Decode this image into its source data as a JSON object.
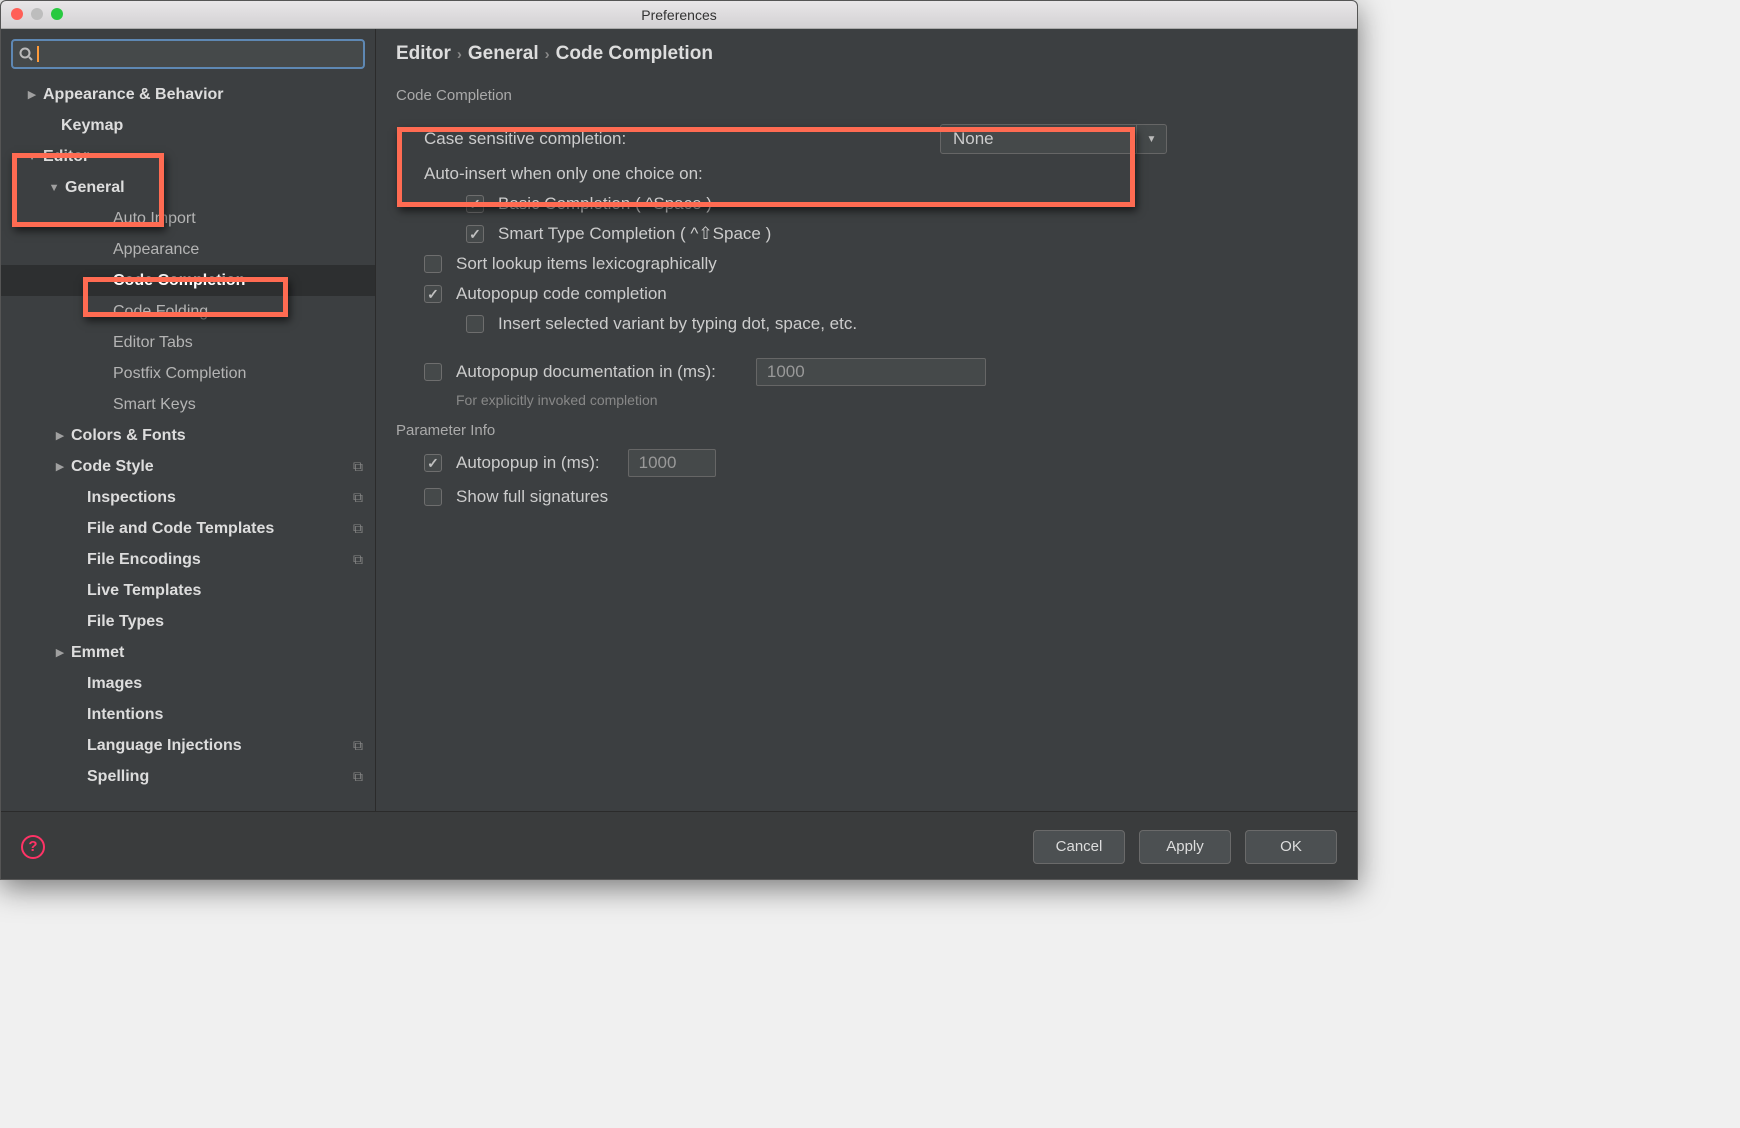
{
  "window_title": "Preferences",
  "sidebar": {
    "items": [
      {
        "label": "Appearance & Behavior",
        "indent": 26,
        "arrow": "▶",
        "bold": true
      },
      {
        "label": "Keymap",
        "indent": 44,
        "arrow": "",
        "bold": true
      },
      {
        "label": "Editor",
        "indent": 26,
        "arrow": "▼",
        "bold": true
      },
      {
        "label": "General",
        "indent": 48,
        "arrow": "▼",
        "bold": true
      },
      {
        "label": "Auto Import",
        "indent": 96,
        "arrow": ""
      },
      {
        "label": "Appearance",
        "indent": 96,
        "arrow": ""
      },
      {
        "label": "Code Completion",
        "indent": 96,
        "arrow": "",
        "selected": true
      },
      {
        "label": "Code Folding",
        "indent": 96,
        "arrow": ""
      },
      {
        "label": "Editor Tabs",
        "indent": 96,
        "arrow": ""
      },
      {
        "label": "Postfix Completion",
        "indent": 96,
        "arrow": ""
      },
      {
        "label": "Smart Keys",
        "indent": 96,
        "arrow": ""
      },
      {
        "label": "Colors & Fonts",
        "indent": 54,
        "arrow": "▶",
        "bold": true
      },
      {
        "label": "Code Style",
        "indent": 54,
        "arrow": "▶",
        "bold": true,
        "trail": "⧉"
      },
      {
        "label": "Inspections",
        "indent": 70,
        "arrow": "",
        "bold": true,
        "trail": "⧉"
      },
      {
        "label": "File and Code Templates",
        "indent": 70,
        "arrow": "",
        "bold": true,
        "trail": "⧉"
      },
      {
        "label": "File Encodings",
        "indent": 70,
        "arrow": "",
        "bold": true,
        "trail": "⧉"
      },
      {
        "label": "Live Templates",
        "indent": 70,
        "arrow": "",
        "bold": true
      },
      {
        "label": "File Types",
        "indent": 70,
        "arrow": "",
        "bold": true
      },
      {
        "label": "Emmet",
        "indent": 54,
        "arrow": "▶",
        "bold": true
      },
      {
        "label": "Images",
        "indent": 70,
        "arrow": "",
        "bold": true
      },
      {
        "label": "Intentions",
        "indent": 70,
        "arrow": "",
        "bold": true
      },
      {
        "label": "Language Injections",
        "indent": 70,
        "arrow": "",
        "bold": true,
        "trail": "⧉"
      },
      {
        "label": "Spelling",
        "indent": 70,
        "arrow": "",
        "bold": true,
        "trail": "⧉"
      }
    ]
  },
  "breadcrumb": {
    "a": "Editor",
    "b": "General",
    "c": "Code Completion"
  },
  "sections": {
    "code_completion": {
      "title": "Code Completion",
      "case_label": "Case sensitive completion:",
      "case_value": "None",
      "auto_insert": "Auto-insert when only one choice on:",
      "basic": "Basic Completion ( ^Space )",
      "smart": "Smart Type Completion ( ^⇧Space )",
      "sort": "Sort lookup items lexicographically",
      "autopop": "Autopopup code completion",
      "insert_dot": "Insert selected variant by typing dot, space, etc.",
      "doc_label": "Autopopup documentation in (ms):",
      "doc_value": "1000",
      "doc_hint": "For explicitly invoked completion"
    },
    "param": {
      "title": "Parameter Info",
      "autopop": "Autopopup in (ms):",
      "value": "1000",
      "full": "Show full signatures"
    }
  },
  "footer": {
    "cancel": "Cancel",
    "apply": "Apply",
    "ok": "OK"
  }
}
